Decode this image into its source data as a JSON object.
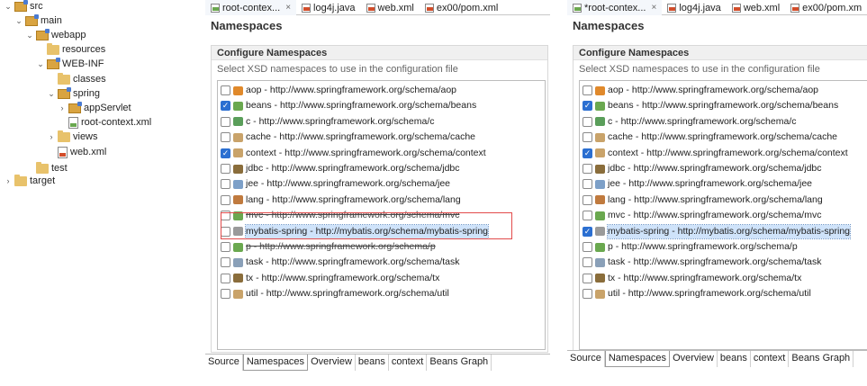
{
  "tree": {
    "items": [
      {
        "label": "src",
        "icon": "package-folder-icon",
        "expand": "v",
        "level": 0
      },
      {
        "label": "main",
        "icon": "package-folder-icon",
        "expand": "v",
        "level": 1
      },
      {
        "label": "webapp",
        "icon": "package-folder-icon",
        "expand": "v",
        "level": 2
      },
      {
        "label": "resources",
        "icon": "folder-icon",
        "expand": "",
        "level": 3
      },
      {
        "label": "WEB-INF",
        "icon": "package-folder-icon",
        "expand": "v",
        "level": 3
      },
      {
        "label": "classes",
        "icon": "folder-icon",
        "expand": "",
        "level": 4
      },
      {
        "label": "spring",
        "icon": "package-folder-icon",
        "expand": "v",
        "level": 4
      },
      {
        "label": "appServlet",
        "icon": "package-folder-icon",
        "expand": ">",
        "level": 5
      },
      {
        "label": "root-context.xml",
        "icon": "spring-xml-file-icon",
        "expand": "",
        "level": 5
      },
      {
        "label": "views",
        "icon": "folder-icon",
        "expand": ">",
        "level": 4
      },
      {
        "label": "web.xml",
        "icon": "xml-file-icon",
        "expand": "",
        "level": 4
      },
      {
        "label": "test",
        "icon": "folder-icon",
        "expand": "",
        "level": 2
      },
      {
        "label": "target",
        "icon": "folder-icon",
        "expand": ">",
        "level": 0
      }
    ]
  },
  "left_editor": {
    "tabs": [
      {
        "label": "root-contex...",
        "close": "×",
        "icon": "spring-xml-file-icon",
        "active": true
      },
      {
        "label": "log4j.java",
        "icon": "java-file-icon"
      },
      {
        "label": "web.xml",
        "icon": "xml-file-icon"
      },
      {
        "label": "ex00/pom.xml",
        "icon": "maven-file-icon"
      }
    ],
    "title": "Namespaces",
    "section_title": "Configure Namespaces",
    "section_desc": "Select XSD namespaces to use in the configuration file",
    "namespaces": [
      {
        "label": "aop - http://www.springframework.org/schema/aop",
        "checked": false,
        "color": "#e0892b"
      },
      {
        "label": "beans - http://www.springframework.org/schema/beans",
        "checked": true,
        "color": "#6aa84f"
      },
      {
        "label": "c - http://www.springframework.org/schema/c",
        "checked": false,
        "color": "#5a9e5a"
      },
      {
        "label": "cache - http://www.springframework.org/schema/cache",
        "checked": false,
        "color": "#c9a36a"
      },
      {
        "label": "context - http://www.springframework.org/schema/context",
        "checked": true,
        "color": "#c9a36a"
      },
      {
        "label": "jdbc - http://www.springframework.org/schema/jdbc",
        "checked": false,
        "color": "#8a6d3b"
      },
      {
        "label": "jee - http://www.springframework.org/schema/jee",
        "checked": false,
        "color": "#7da0c8"
      },
      {
        "label": "lang - http://www.springframework.org/schema/lang",
        "checked": false,
        "color": "#c07a3e"
      },
      {
        "label": "mvc - http://www.springframework.org/schema/mvc",
        "checked": false,
        "color": "#6aa84f",
        "strike": true
      },
      {
        "label": "mybatis-spring - http://mybatis.org/schema/mybatis-spring",
        "checked": false,
        "color": "#9a9a9a",
        "selected": true
      },
      {
        "label": "p - http://www.springframework.org/schema/p",
        "checked": false,
        "color": "#6aa84f",
        "strike": true
      },
      {
        "label": "task - http://www.springframework.org/schema/task",
        "checked": false,
        "color": "#8aa0b8"
      },
      {
        "label": "tx - http://www.springframework.org/schema/tx",
        "checked": false,
        "color": "#8a6d3b"
      },
      {
        "label": "util - http://www.springframework.org/schema/util",
        "checked": false,
        "color": "#c9a36a"
      }
    ],
    "bottom_tabs": [
      {
        "label": "Source"
      },
      {
        "label": "Namespaces",
        "active": true
      },
      {
        "label": "Overview"
      },
      {
        "label": "beans"
      },
      {
        "label": "context"
      },
      {
        "label": "Beans Graph"
      }
    ]
  },
  "right_editor": {
    "tabs": [
      {
        "label": "*root-contex...",
        "close": "×",
        "icon": "spring-xml-file-icon",
        "active": true
      },
      {
        "label": "log4j.java",
        "icon": "java-file-icon"
      },
      {
        "label": "web.xml",
        "icon": "xml-file-icon"
      },
      {
        "label": "ex00/pom.xm",
        "icon": "maven-file-icon"
      }
    ],
    "title": "Namespaces",
    "section_title": "Configure Namespaces",
    "section_desc": "Select XSD namespaces to use in the configuration file",
    "namespaces": [
      {
        "label": "aop - http://www.springframework.org/schema/aop",
        "checked": false,
        "color": "#e0892b"
      },
      {
        "label": "beans - http://www.springframework.org/schema/beans",
        "checked": true,
        "color": "#6aa84f"
      },
      {
        "label": "c - http://www.springframework.org/schema/c",
        "checked": false,
        "color": "#5a9e5a"
      },
      {
        "label": "cache - http://www.springframework.org/schema/cache",
        "checked": false,
        "color": "#c9a36a"
      },
      {
        "label": "context - http://www.springframework.org/schema/context",
        "checked": true,
        "color": "#c9a36a"
      },
      {
        "label": "jdbc - http://www.springframework.org/schema/jdbc",
        "checked": false,
        "color": "#8a6d3b"
      },
      {
        "label": "jee - http://www.springframework.org/schema/jee",
        "checked": false,
        "color": "#7da0c8"
      },
      {
        "label": "lang - http://www.springframework.org/schema/lang",
        "checked": false,
        "color": "#c07a3e"
      },
      {
        "label": "mvc - http://www.springframework.org/schema/mvc",
        "checked": false,
        "color": "#6aa84f"
      },
      {
        "label": "mybatis-spring - http://mybatis.org/schema/mybatis-spring",
        "checked": true,
        "color": "#9a9a9a",
        "selected": true
      },
      {
        "label": "p - http://www.springframework.org/schema/p",
        "checked": false,
        "color": "#6aa84f"
      },
      {
        "label": "task - http://www.springframework.org/schema/task",
        "checked": false,
        "color": "#8aa0b8"
      },
      {
        "label": "tx - http://www.springframework.org/schema/tx",
        "checked": false,
        "color": "#8a6d3b"
      },
      {
        "label": "util - http://www.springframework.org/schema/util",
        "checked": false,
        "color": "#c9a36a"
      }
    ],
    "bottom_tabs": [
      {
        "label": "Source"
      },
      {
        "label": "Namespaces",
        "active": true
      },
      {
        "label": "Overview"
      },
      {
        "label": "beans"
      },
      {
        "label": "context"
      },
      {
        "label": "Beans Graph"
      }
    ]
  }
}
